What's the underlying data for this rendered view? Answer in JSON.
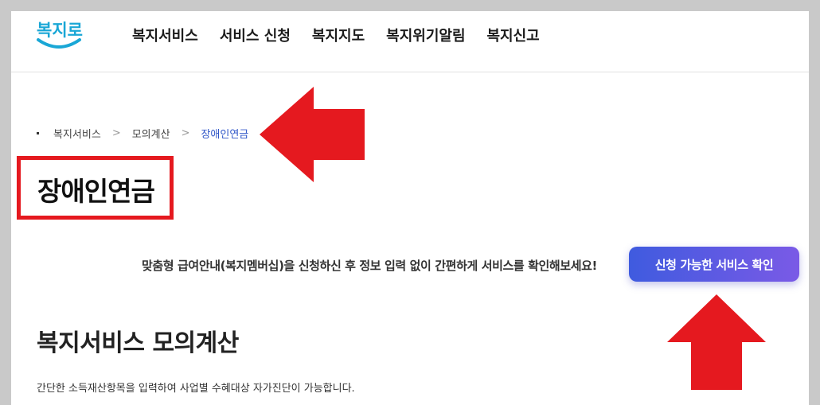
{
  "logo": {
    "text": "복지로"
  },
  "nav": {
    "items": [
      "복지서비스",
      "서비스 신청",
      "복지지도",
      "복지위기알림",
      "복지신고"
    ]
  },
  "breadcrumb": {
    "items": [
      "복지서비스",
      "모의계산",
      "장애인연금"
    ],
    "separator": ">"
  },
  "page": {
    "title": "장애인연금"
  },
  "promo": {
    "text": "맞춤형 급여안내(복지멤버십)을 신청하신 후 정보 입력 없이 간편하게 서비스를 확인해보세요!",
    "button_label": "신청 가능한 서비스 확인"
  },
  "section": {
    "title": "복지서비스 모의계산",
    "description": "간단한 소득재산항목을 입력하여 사업별 수혜대상 자가진단이 가능합니다."
  },
  "colors": {
    "annotation_red": "#e5191f",
    "cta_start": "#3f5bdf",
    "cta_end": "#7a5ae6",
    "breadcrumb_active": "#2f56c8"
  }
}
